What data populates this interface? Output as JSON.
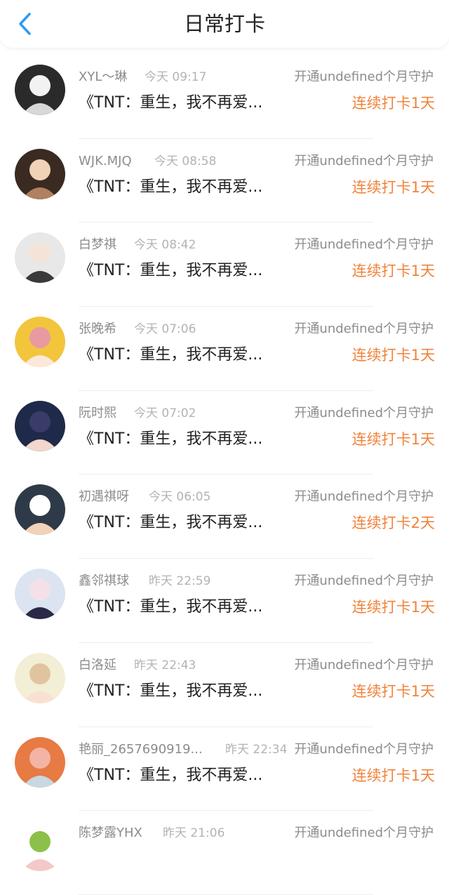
{
  "header": {
    "title": "日常打卡",
    "back_icon": "chevron-left-icon",
    "accent": "#2d9cf0"
  },
  "colors": {
    "streak": "#f0833a",
    "name": "#8c8c8c",
    "time": "#b3b3b3"
  },
  "rows": [
    {
      "name": "XYL～琳",
      "time": "今天 09:17",
      "guard": "开通undefined个月守护",
      "message": "《TNT：重生，我不再爱...",
      "streak": "连续打卡1天"
    },
    {
      "name": "WJK.MJQ",
      "time": "今天 08:58",
      "guard": "开通undefined个月守护",
      "message": "《TNT：重生，我不再爱...",
      "streak": "连续打卡1天"
    },
    {
      "name": "白梦祺",
      "time": "今天 08:42",
      "guard": "开通undefined个月守护",
      "message": "《TNT：重生，我不再爱...",
      "streak": "连续打卡1天"
    },
    {
      "name": "张晚希",
      "time": "今天 07:06",
      "guard": "开通undefined个月守护",
      "message": "《TNT：重生，我不再爱...",
      "streak": "连续打卡1天"
    },
    {
      "name": "阮时熙",
      "time": "今天 07:02",
      "guard": "开通undefined个月守护",
      "message": "《TNT：重生，我不再爱...",
      "streak": "连续打卡1天"
    },
    {
      "name": "初遇祺呀",
      "time": "今天 06:05",
      "guard": "开通undefined个月守护",
      "message": "《TNT：重生，我不再爱...",
      "streak": "连续打卡2天"
    },
    {
      "name": "鑫邻祺球",
      "time": "昨天 22:59",
      "guard": "开通undefined个月守护",
      "message": "《TNT：重生，我不再爱...",
      "streak": "连续打卡1天"
    },
    {
      "name": "白洛延",
      "time": "昨天 22:43",
      "guard": "开通undefined个月守护",
      "message": "《TNT：重生，我不再爱...",
      "streak": "连续打卡1天"
    },
    {
      "name": "艳丽_2657690919...",
      "time": "昨天 22:34",
      "guard": "开通undefined个月守护",
      "message": "《TNT：重生，我不再爱...",
      "streak": "连续打卡1天"
    },
    {
      "name": "陈梦露YHX",
      "time": "昨天 21:06",
      "guard": "开通undefined个月守护",
      "message": "",
      "streak": ""
    }
  ]
}
